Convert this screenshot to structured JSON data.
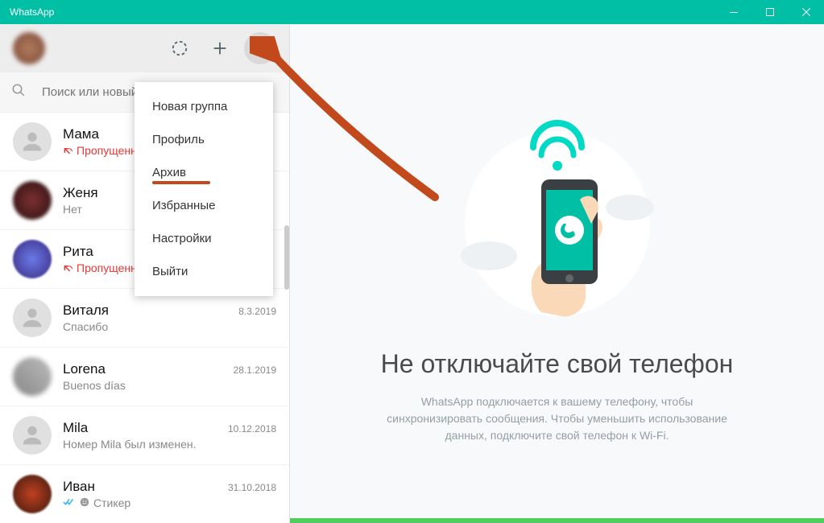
{
  "window": {
    "title": "WhatsApp"
  },
  "search": {
    "placeholder": "Поиск или новый чат"
  },
  "menu": {
    "items": [
      {
        "label": "Новая группа"
      },
      {
        "label": "Профиль"
      },
      {
        "label": "Архив",
        "highlighted": true
      },
      {
        "label": "Избранные"
      },
      {
        "label": "Настройки"
      },
      {
        "label": "Выйти"
      }
    ]
  },
  "chats": [
    {
      "name": "Мама",
      "preview": "Пропущенный звонок",
      "date": "",
      "missed": true,
      "avatar": "default"
    },
    {
      "name": "Женя",
      "preview": "Нет",
      "date": "",
      "missed": false,
      "avatar": "c1"
    },
    {
      "name": "Рита",
      "preview": "Пропущенный звонок",
      "date": "",
      "missed": true,
      "avatar": "c2"
    },
    {
      "name": "Виталя",
      "preview": "Спасибо",
      "date": "8.3.2019",
      "missed": false,
      "avatar": "default"
    },
    {
      "name": "Lorena",
      "preview": "Buenos días",
      "date": "28.1.2019",
      "missed": false,
      "avatar": "c3"
    },
    {
      "name": "Mila",
      "preview": "Номер Mila был изменен.",
      "date": "10.12.2018",
      "missed": false,
      "avatar": "default"
    },
    {
      "name": "Иван",
      "preview": "Стикер",
      "date": "31.10.2018",
      "missed": false,
      "avatar": "c4",
      "ticks": true,
      "sticker": true
    }
  ],
  "main": {
    "headline": "Не отключайте свой телефон",
    "sub": "WhatsApp подключается к вашему телефону, чтобы синхронизировать сообщения. Чтобы уменьшить использование данных, подключите свой телефон к Wi-Fi."
  }
}
